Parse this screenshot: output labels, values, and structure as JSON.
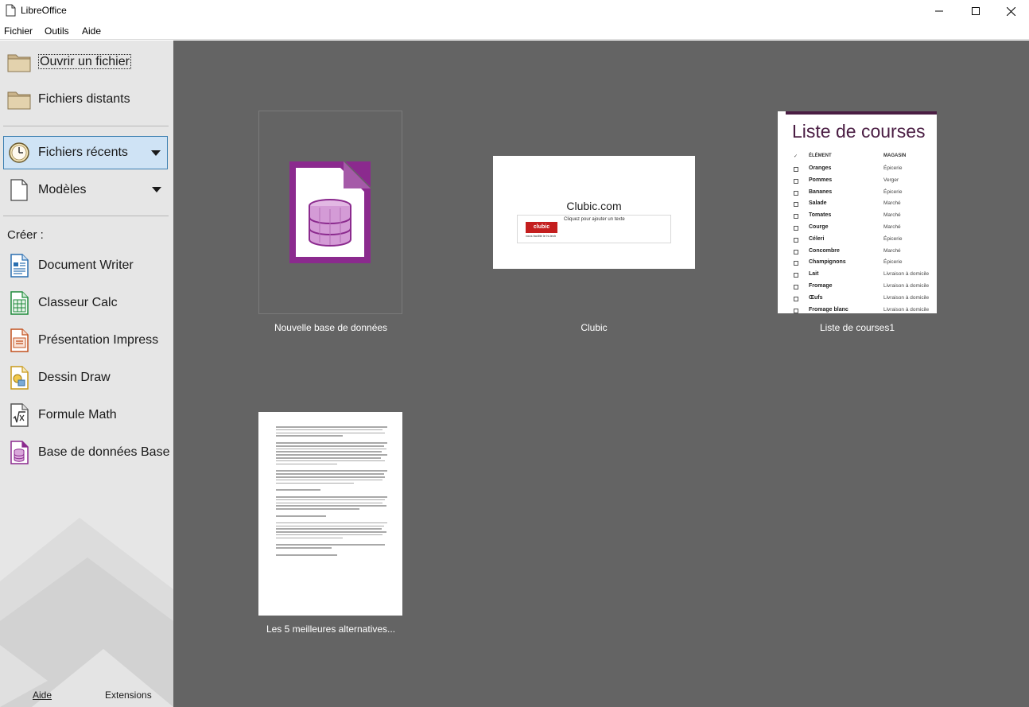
{
  "window": {
    "title": "LibreOffice",
    "controls": {
      "minimize_icon": "minimize-icon",
      "maximize_icon": "maximize-icon",
      "close_icon": "close-icon"
    }
  },
  "menubar": {
    "items": [
      {
        "label": "Fichier"
      },
      {
        "label": "Outils"
      },
      {
        "label": "Aide"
      }
    ]
  },
  "sidebar": {
    "open_file": {
      "label": "Ouvrir un fichier",
      "icon": "folder-icon"
    },
    "remote_files": {
      "label": "Fichiers distants",
      "icon": "folder-icon"
    },
    "recent_files": {
      "label": "Fichiers récents",
      "icon": "clock-icon",
      "active": true
    },
    "templates": {
      "label": "Modèles",
      "icon": "document-icon"
    },
    "create_label": "Créer :",
    "create_items": [
      {
        "label": "Document Writer",
        "icon": "writer-icon",
        "color": "#2a6fb0"
      },
      {
        "label": "Classeur Calc",
        "icon": "calc-icon",
        "color": "#1e8a3a"
      },
      {
        "label": "Présentation Impress",
        "icon": "impress-icon",
        "color": "#c2501e"
      },
      {
        "label": "Dessin Draw",
        "icon": "draw-icon",
        "color": "#c99a1a"
      },
      {
        "label": "Formule Math",
        "icon": "math-icon",
        "color": "#555555"
      },
      {
        "label": "Base de données Base",
        "icon": "base-icon",
        "color": "#8b2a8e"
      }
    ],
    "footer": {
      "help_label": "Aide",
      "extensions_label": "Extensions"
    }
  },
  "recent_documents": [
    {
      "name": "Nouvelle base de données",
      "type": "database"
    },
    {
      "name": "Clubic",
      "type": "presentation",
      "slide_title": "Clubic.com",
      "slide_subtitle": "Cliquez pour ajouter un texte",
      "logo_text": "clubic",
      "logo_tagline": "vous facilite le hi-tech"
    },
    {
      "name": "Liste de courses1",
      "type": "spreadsheet"
    },
    {
      "name": "Les 5 meilleures alternatives...",
      "type": "text"
    }
  ],
  "shopping_list": {
    "title": "Liste de courses",
    "header_check": "✓",
    "header_item": "ÉLÉMENT",
    "header_store": "MAGASIN",
    "rows": [
      {
        "item": "Oranges",
        "store": "Épicerie"
      },
      {
        "item": "Pommes",
        "store": "Verger"
      },
      {
        "item": "Bananes",
        "store": "Épicerie"
      },
      {
        "item": "Salade",
        "store": "Marché"
      },
      {
        "item": "Tomates",
        "store": "Marché"
      },
      {
        "item": "Courge",
        "store": "Marché"
      },
      {
        "item": "Céleri",
        "store": "Épicerie"
      },
      {
        "item": "Concombre",
        "store": "Marché"
      },
      {
        "item": "Champignons",
        "store": "Épicerie"
      },
      {
        "item": "Lait",
        "store": "Livraison à domicile"
      },
      {
        "item": "Fromage",
        "store": "Livraison à domicile"
      },
      {
        "item": "Œufs",
        "store": "Livraison à domicile"
      },
      {
        "item": "Fromage blanc",
        "store": "Livraison à domicile"
      }
    ]
  },
  "colors": {
    "sidebar_bg": "#e6e6e6",
    "main_bg": "#646464",
    "active_bg": "#cfe3f5",
    "active_border": "#3c7fb1",
    "base_purple": "#8b2a8e",
    "list_purple": "#4a1d43"
  }
}
